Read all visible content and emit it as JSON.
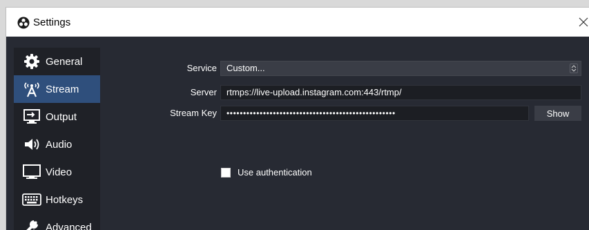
{
  "window": {
    "title": "Settings"
  },
  "sidebar": {
    "items": [
      {
        "label": "General",
        "icon": "gear-icon",
        "active": false
      },
      {
        "label": "Stream",
        "icon": "broadcast-icon",
        "active": true
      },
      {
        "label": "Output",
        "icon": "output-icon",
        "active": false
      },
      {
        "label": "Audio",
        "icon": "speaker-icon",
        "active": false
      },
      {
        "label": "Video",
        "icon": "monitor-icon",
        "active": false
      },
      {
        "label": "Hotkeys",
        "icon": "keyboard-icon",
        "active": false
      },
      {
        "label": "Advanced",
        "icon": "wrench-icon",
        "active": false
      }
    ]
  },
  "stream": {
    "service_label": "Service",
    "service_value": "Custom...",
    "server_label": "Server",
    "server_value": "rtmps://live-upload.instagram.com:443/rtmp/",
    "key_label": "Stream Key",
    "key_value": "•••••••••••••••••••••••••••••••••••••••••••••••••••",
    "show_label": "Show",
    "auth_label": "Use authentication",
    "auth_checked": false
  },
  "colors": {
    "panel": "#272a33",
    "sidebar": "#1f2127",
    "active_item": "#2f4f7c",
    "field": "#1c1e23",
    "button": "#3a3d46"
  }
}
